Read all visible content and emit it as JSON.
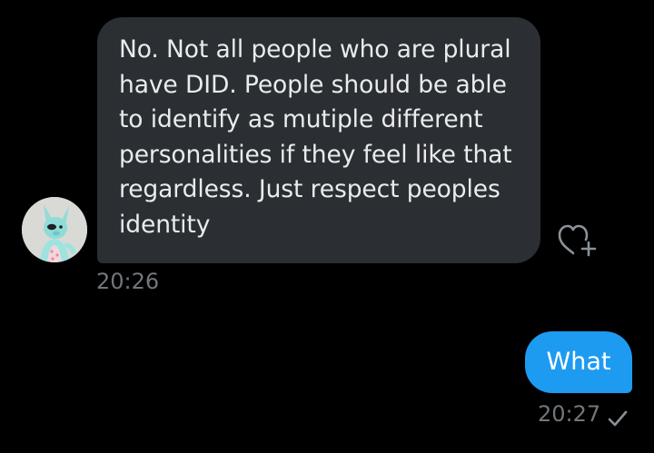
{
  "conversation": {
    "received_message": {
      "lines": [
        "No. Not all people who are plural",
        "have DID. People should be able",
        "to identify as mutiple different",
        "personalities if they feel like that",
        "regardless. Just respect peoples",
        "identity"
      ],
      "timestamp": "20:26",
      "avatar_icon": "cartoon-creature-avatar",
      "react_icon": "heart-plus-icon"
    },
    "sent_message": {
      "text": "What",
      "timestamp": "20:27",
      "status_icon": "check-icon"
    }
  },
  "colors": {
    "background": "#000000",
    "received_bubble": "#2b2f33",
    "sent_bubble": "#1d9bf0",
    "timestamp": "#71767b"
  }
}
